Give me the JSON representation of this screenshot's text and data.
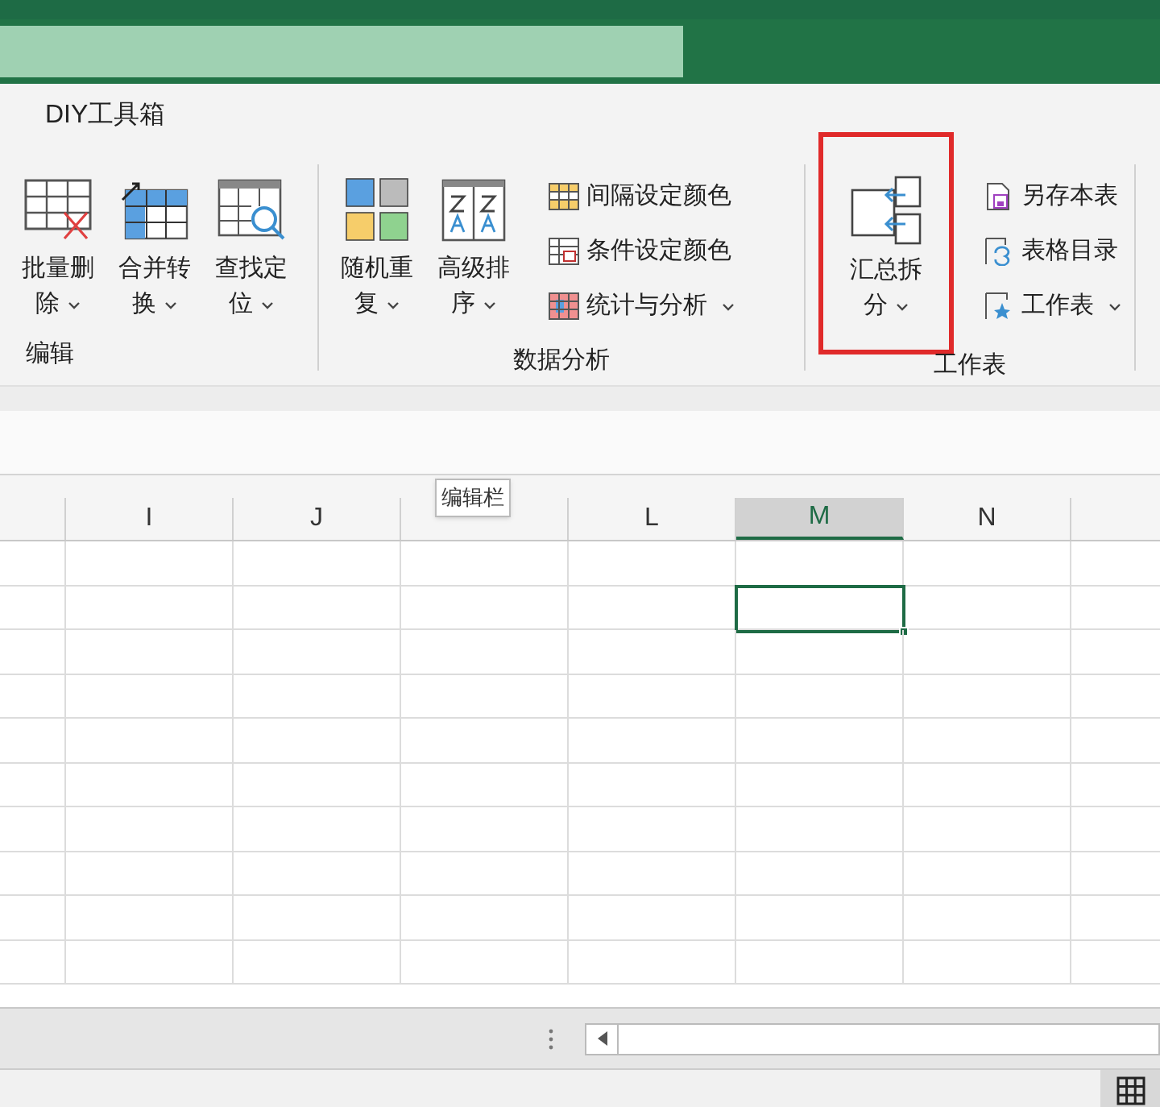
{
  "ribbon": {
    "tab": "DIY工具箱",
    "groups": [
      {
        "label": "编辑",
        "items": [
          {
            "kind": "large",
            "label": "批量删除",
            "dropdown": true,
            "highlighted": false
          },
          {
            "kind": "large",
            "label": "合并转换",
            "dropdown": true,
            "highlighted": false
          },
          {
            "kind": "large",
            "label": "查找定位",
            "dropdown": true,
            "highlighted": false
          }
        ]
      },
      {
        "label": "数据分析",
        "items": [
          {
            "kind": "large",
            "label": "随机重复",
            "dropdown": true,
            "highlighted": false
          },
          {
            "kind": "large",
            "label": "高级排序",
            "dropdown": true,
            "highlighted": false
          },
          {
            "kind": "small",
            "label": "间隔设定颜色",
            "dropdown": false
          },
          {
            "kind": "small",
            "label": "条件设定颜色",
            "dropdown": false
          },
          {
            "kind": "small",
            "label": "统计与分析",
            "dropdown": true
          }
        ]
      },
      {
        "label": "工作表",
        "items": [
          {
            "kind": "large",
            "label": "汇总拆分",
            "dropdown": true,
            "highlighted": true
          },
          {
            "kind": "small",
            "label": "另存本表",
            "dropdown": false
          },
          {
            "kind": "small",
            "label": "表格目录",
            "dropdown": false
          },
          {
            "kind": "small",
            "label": "工作表",
            "dropdown": true
          }
        ]
      }
    ]
  },
  "tooltip": "编辑栏",
  "columns": [
    {
      "label": "I",
      "selected": false
    },
    {
      "label": "J",
      "selected": false
    },
    {
      "selected": false
    },
    {
      "label": "L",
      "selected": false
    },
    {
      "label": "M",
      "selected": true
    },
    {
      "label": "N",
      "selected": false
    }
  ]
}
